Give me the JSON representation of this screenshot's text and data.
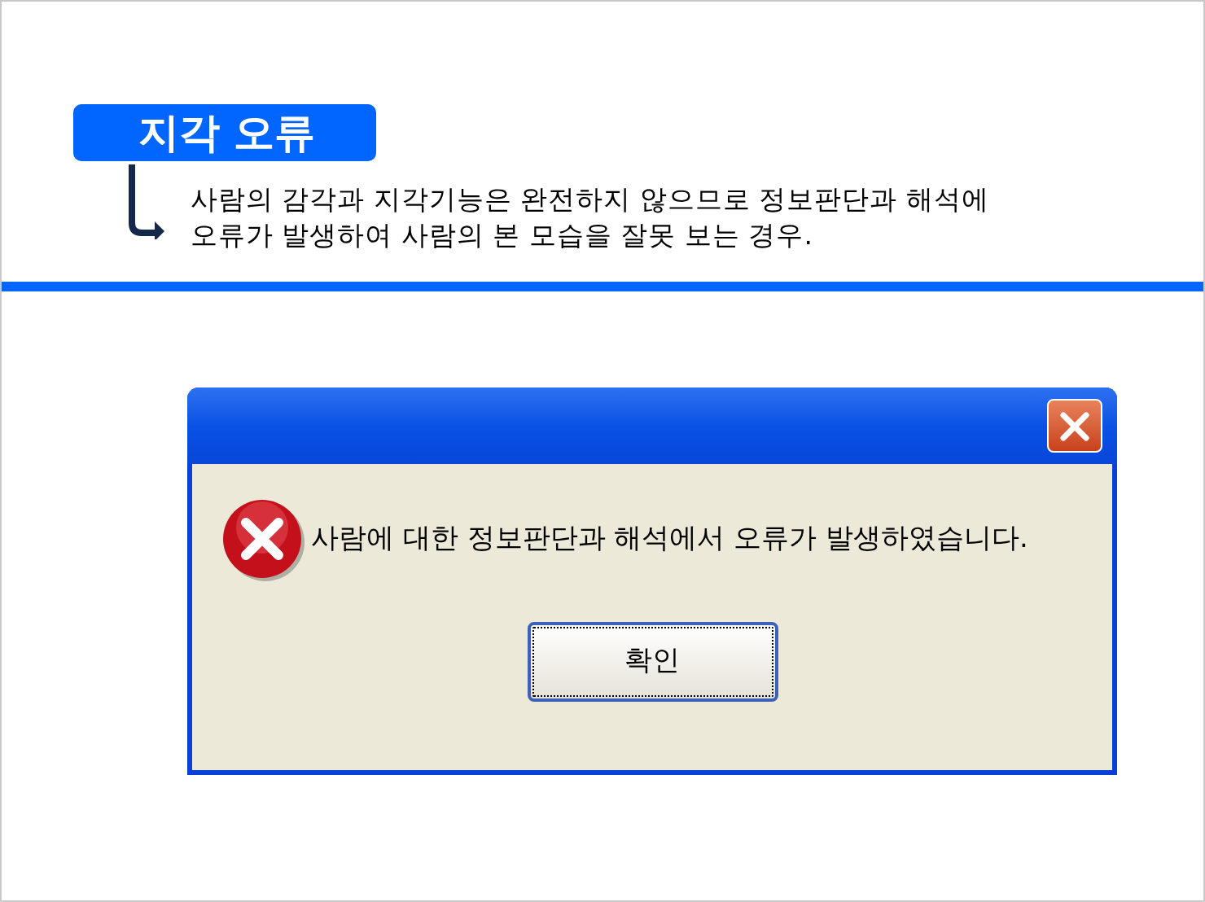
{
  "heading": {
    "title": "지각 오류",
    "description_lines": [
      "사람의 감각과 지각기능은 완전하지 않으므로 정보판단과 해석에",
      "오류가 발생하여 사람의 본 모습을 잘못 보는 경우."
    ]
  },
  "dialog": {
    "message": "사람에 대한 정보판단과 해석에서 오류가 발생하였습니다.",
    "buttons": [
      {
        "label": "확인",
        "selected": true
      }
    ]
  }
}
